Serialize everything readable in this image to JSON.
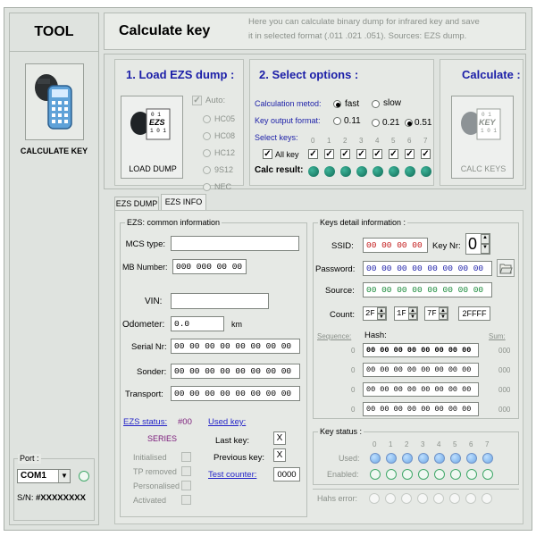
{
  "sidebar": {
    "title": "TOOL",
    "calculate_key_label": "CALCULATE KEY",
    "port_label": "Port :",
    "port_value": "COM1",
    "sn_label": "S/N:",
    "sn_value": "#XXXXXXXX"
  },
  "header": {
    "title": "Calculate key",
    "desc_line1": "Here you can calculate binary dump for infrared key and save",
    "desc_line2": "it in selected format (.011 .021 .051). Sources:   EZS dump."
  },
  "load": {
    "title": "1. Load EZS dump :",
    "button_label": "LOAD DUMP",
    "chip_line1": "0 1",
    "chip_line2": "EZS",
    "chip_line3": "1 0 1",
    "auto_label": "Auto:",
    "chips": [
      "HC05",
      "HC08",
      "HC12",
      "9S12",
      "NEC"
    ]
  },
  "options": {
    "title": "2. Select options :",
    "method_label": "Calculation metod:",
    "fast_label": "fast",
    "slow_label": "slow",
    "format_label": "Key output format:",
    "formats": [
      "0.11",
      "0.21",
      "0.51"
    ],
    "select_keys_label": "Select keys:",
    "key_numbers": [
      "0",
      "1",
      "2",
      "3",
      "4",
      "5",
      "6",
      "7"
    ],
    "all_key_label": "All key",
    "calc_result_label": "Calc result:"
  },
  "calculate": {
    "title": "Calculate :",
    "button_label": "CALC KEYS",
    "chip_line1": "0 1",
    "chip_line2": "KEY",
    "chip_line3": "1 0 1"
  },
  "tabs": [
    "EZS DUMP",
    "EZS INFO"
  ],
  "ezs": {
    "legend": "EZS: common information",
    "mcs_label": "MCS type:",
    "mcs_value": "",
    "mb_label": "MB Number:",
    "mb_value": "000 000 00 00",
    "vin_label": "VIN:",
    "vin_value": "",
    "odometer_label": "Odometer:",
    "odometer_value": "0.0",
    "odometer_unit": "km",
    "serial_label": "Serial Nr:",
    "serial_value": "00 00 00 00 00 00 00 00",
    "sonder_label": "Sonder:",
    "sonder_value": "00 00 00 00 00 00 00 00",
    "transport_label": "Transport:",
    "transport_value": "00 00 00 00 00 00 00 00",
    "status_label": "EZS status:",
    "status_value": "#00",
    "series_label": "SERIES",
    "flags": [
      "Initialised",
      "TP removed",
      "Personalised",
      "Activated"
    ],
    "used_key_label": "Used key:",
    "last_key_label": "Last key:",
    "last_key_value": "X",
    "prev_key_label": "Previous key:",
    "prev_key_value": "X",
    "test_counter_label": "Test counter:",
    "test_counter_value": "0000"
  },
  "keys": {
    "legend": "Keys detail information :",
    "ssid_label": "SSID:",
    "ssid_value": "00 00 00 00",
    "keynr_label": "Key Nr:",
    "keynr_value": "0",
    "password_label": "Password:",
    "password_value": "00 00 00 00 00 00 00 00",
    "source_label": "Source:",
    "source_value": "00 00 00 00 00 00 00 00",
    "count_label": "Count:",
    "count_values": [
      "2F",
      "1F",
      "7F"
    ],
    "count_total": "2FFFF",
    "sequence_label": "Sequence:",
    "hash_label": "Hash:",
    "sum_label": "Sum:",
    "hash_rows": [
      {
        "seq": "0",
        "hash": "00 00 00 00 00 00 00 00",
        "sum": "000"
      },
      {
        "seq": "0",
        "hash": "00 00 00 00 00 00 00 00",
        "sum": "000"
      },
      {
        "seq": "0",
        "hash": "00 00 00 00 00 00 00 00",
        "sum": "000"
      },
      {
        "seq": "0",
        "hash": "00 00 00 00 00 00 00 00",
        "sum": "000"
      }
    ]
  },
  "key_status": {
    "legend": "Key status :",
    "numbers": [
      "0",
      "1",
      "2",
      "3",
      "4",
      "5",
      "6",
      "7"
    ],
    "used_label": "Used:",
    "enabled_label": "Enabled:",
    "hash_error_label": "Hahs error:"
  }
}
